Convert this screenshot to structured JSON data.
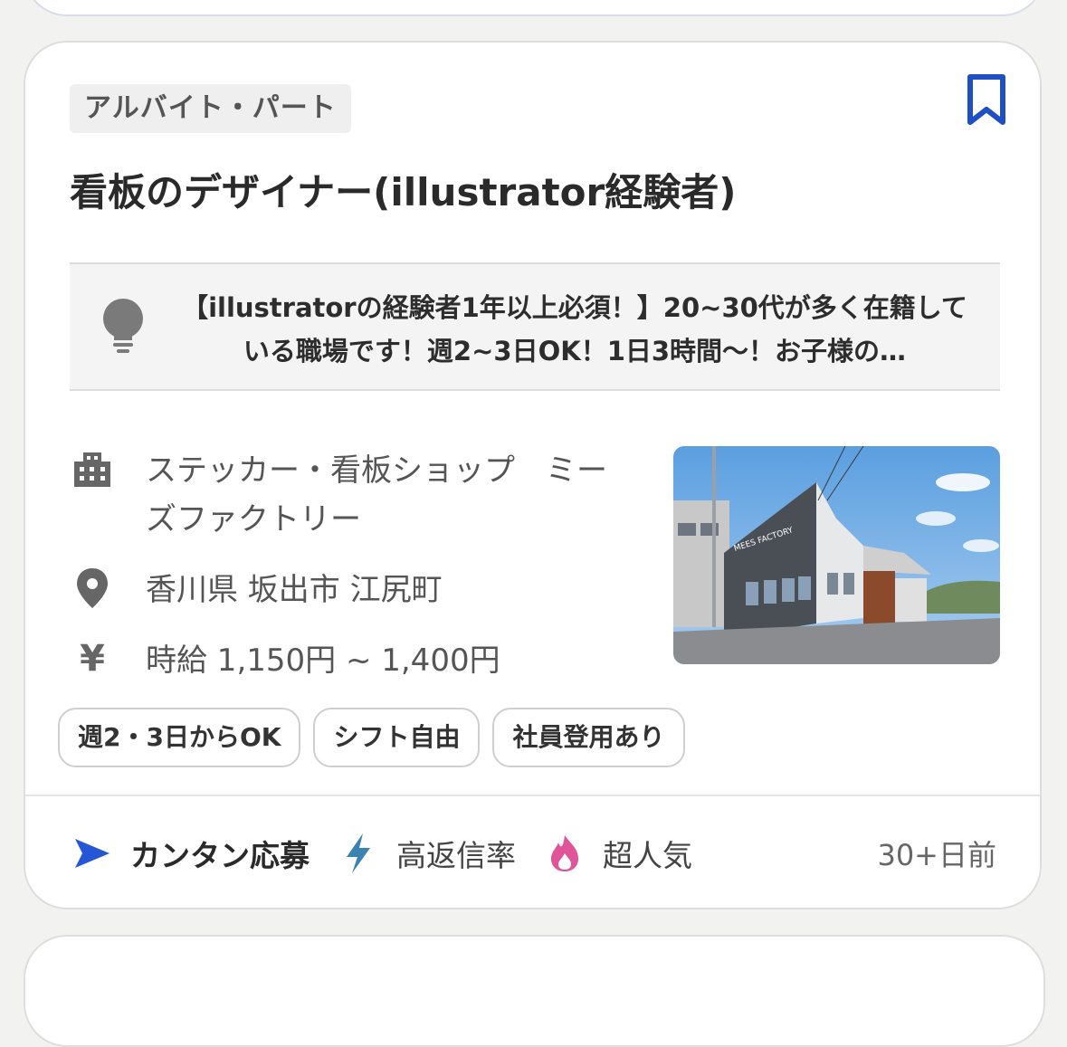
{
  "job": {
    "employment_type": "アルバイト・パート",
    "title": "看板のデザイナー(illustrator経験者)",
    "highlight": "【illustratorの経験者1年以上必須！】20~30代が多く在籍している職場です！週2~3日OK！1日3時間〜！お子様の…",
    "company": "ステッカー・看板ショップ　ミーズファクトリー",
    "location": "香川県 坂出市 江尻町",
    "salary_symbol": "¥",
    "salary": "時給 1,150円 ~ 1,400円",
    "photo_sign": "MEES FACTORY",
    "tags": [
      "週2・3日からOK",
      "シフト自由",
      "社員登用あり"
    ],
    "footer": {
      "apply": "カンタン応募",
      "response": "高返信率",
      "popular": "超人気",
      "posted": "30+日前"
    }
  },
  "colors": {
    "bookmark": "#1f4fc4",
    "apply_arrow": "#2456d6",
    "bolt": "#3a82b0",
    "flame": "#e0559a"
  },
  "icons": [
    "bookmark-icon",
    "lightbulb-icon",
    "building-icon",
    "location-pin-icon",
    "yen-icon",
    "send-arrow-icon",
    "lightning-icon",
    "flame-icon"
  ]
}
